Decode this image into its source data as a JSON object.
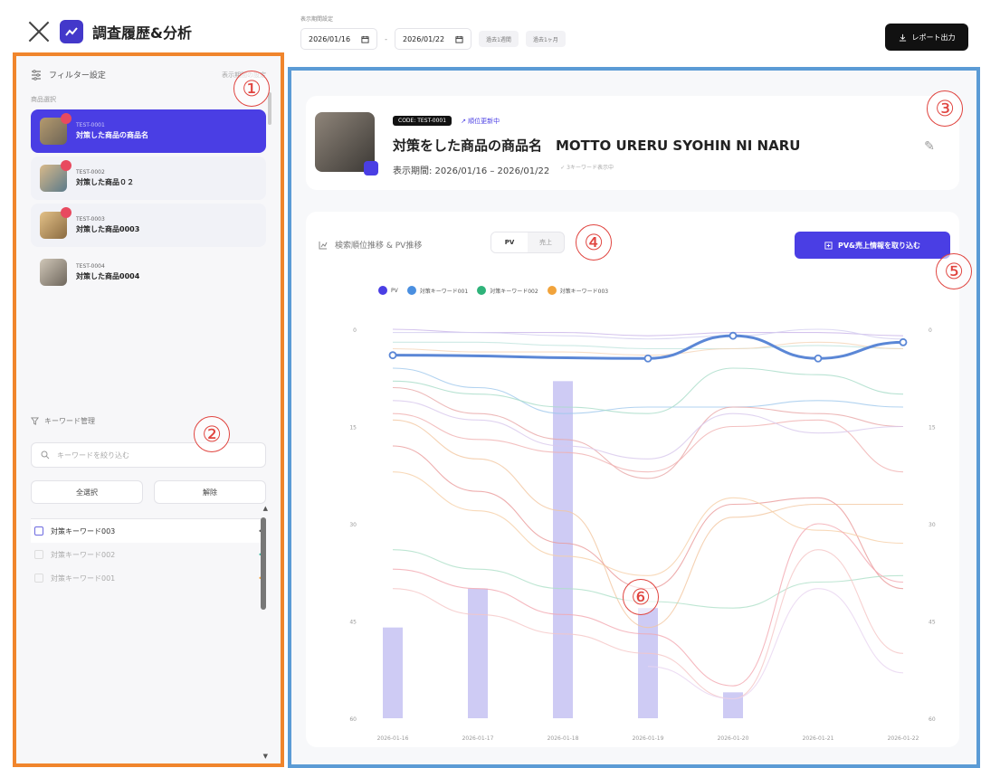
{
  "header": {
    "title": "調査履歴&分析",
    "close_icon": "close-icon",
    "logo_icon": "trend-icon"
  },
  "sidebar": {
    "filter_title": "フィルター設定",
    "filter_hint": "表示期間の設定",
    "list_label": "商品選択",
    "products": [
      {
        "code": "TEST-0001",
        "name": "対策した商品の商品名",
        "active": true
      },
      {
        "code": "TEST-0002",
        "name": "対策した商品０２",
        "active": false
      },
      {
        "code": "TEST-0003",
        "name": "対策した商品0003",
        "active": false
      },
      {
        "code": "TEST-0004",
        "name": "対策した商品0004",
        "active": false
      }
    ],
    "keyword_title": "キーワード管理",
    "keyword_placeholder": "キーワードを絞り込む",
    "select_all": "全選択",
    "clear": "解除",
    "keywords": [
      {
        "label": "対策キーワード003",
        "checked": true
      },
      {
        "label": "対策キーワード002",
        "checked": false
      },
      {
        "label": "対策キーワード001",
        "checked": false
      }
    ]
  },
  "toolbar": {
    "date_label": "表示期間設定",
    "start_date": "2026/01/16",
    "end_date": "2026/01/22",
    "chip1": "過去1週間",
    "chip2": "過去1ヶ月",
    "export_label": "レポート出力"
  },
  "product_card": {
    "code": "CODE: TEST-0001",
    "status": "↗ 順位更新中",
    "name": "対策をした商品の商品名　MOTTO URERU SYOHIN NI NARU",
    "period": "表示期間: 2026/01/16 – 2026/01/22",
    "period_sub": "✓ 3キーワード表示中"
  },
  "chart_card": {
    "title": "検索順位推移 & PV推移",
    "toggle_pv": "PV",
    "toggle_sales": "売上",
    "import_label": "PV&売上情報を取り込む",
    "legend": [
      {
        "name": "PV",
        "color": "#4a3ee4"
      },
      {
        "name": "対策キーワード001",
        "color": "#4a8fe0"
      },
      {
        "name": "対策キーワード002",
        "color": "#2fb37a"
      },
      {
        "name": "対策キーワード003",
        "color": "#f1a33b"
      }
    ]
  },
  "chart_data": {
    "type": "line",
    "categories": [
      "2026-01-16",
      "2026-01-17",
      "2026-01-18",
      "2026-01-19",
      "2026-01-20",
      "2026-01-21",
      "2026-01-22"
    ],
    "y_left_ticks": [
      0,
      15,
      30,
      45,
      60
    ],
    "y_right_ticks": [
      0,
      15,
      30,
      45,
      60
    ],
    "ylim": [
      0,
      60
    ],
    "bars": {
      "name": "PV",
      "color": "#c5c2f2",
      "values": [
        14,
        20,
        52,
        17,
        4,
        null,
        null
      ]
    },
    "series": [
      {
        "color": "#5b87d6",
        "width": 3,
        "markers": true,
        "values": [
          4,
          null,
          null,
          4.5,
          1,
          4.5,
          2
        ]
      },
      {
        "color": "#c9b4e8",
        "values": [
          0,
          0.5,
          0.5,
          1,
          0.5,
          0.5,
          1
        ]
      },
      {
        "color": "#d4d0f0",
        "values": [
          0.5,
          0.5,
          1,
          1.5,
          1,
          0,
          1.5
        ]
      },
      {
        "color": "#bfe3dd",
        "values": [
          2,
          2,
          2.5,
          3,
          3,
          2.5,
          3
        ]
      },
      {
        "color": "#f5d4b8",
        "values": [
          3,
          3.5,
          3.5,
          4,
          3,
          2,
          3
        ]
      },
      {
        "color": "#9fc8ec",
        "values": [
          6,
          9,
          13,
          12,
          12,
          11,
          12
        ]
      },
      {
        "color": "#a8dcc8",
        "values": [
          8,
          10,
          12,
          13,
          6,
          7,
          10
        ]
      },
      {
        "color": "#e9a8a8",
        "values": [
          9,
          13,
          17,
          23,
          12,
          13,
          15
        ]
      },
      {
        "color": "#f0b0b0",
        "values": [
          13,
          17,
          19,
          22,
          15,
          14,
          22
        ]
      },
      {
        "color": "#d8c8ec",
        "values": [
          11,
          14,
          18,
          20,
          13,
          16,
          15
        ]
      },
      {
        "color": "#f3c7a0",
        "values": [
          14,
          20,
          28,
          46,
          29,
          27,
          27
        ]
      },
      {
        "color": "#ea9a9a",
        "values": [
          18,
          25,
          33,
          40,
          27,
          26,
          40
        ]
      },
      {
        "color": "#f6d0a8",
        "values": [
          22,
          28,
          35,
          38,
          26,
          31,
          33
        ]
      },
      {
        "color": "#aee0c8",
        "values": [
          34,
          37,
          40,
          42,
          43,
          39,
          38
        ]
      },
      {
        "color": "#f2a8b0",
        "values": [
          37,
          40,
          44,
          47,
          55,
          30,
          39
        ]
      },
      {
        "color": "#f5c6c6",
        "values": [
          40,
          44,
          47,
          50,
          57,
          34,
          50
        ]
      },
      {
        "color": "#e9d4f0",
        "values": [
          null,
          null,
          null,
          52,
          57,
          40,
          53
        ]
      }
    ]
  }
}
